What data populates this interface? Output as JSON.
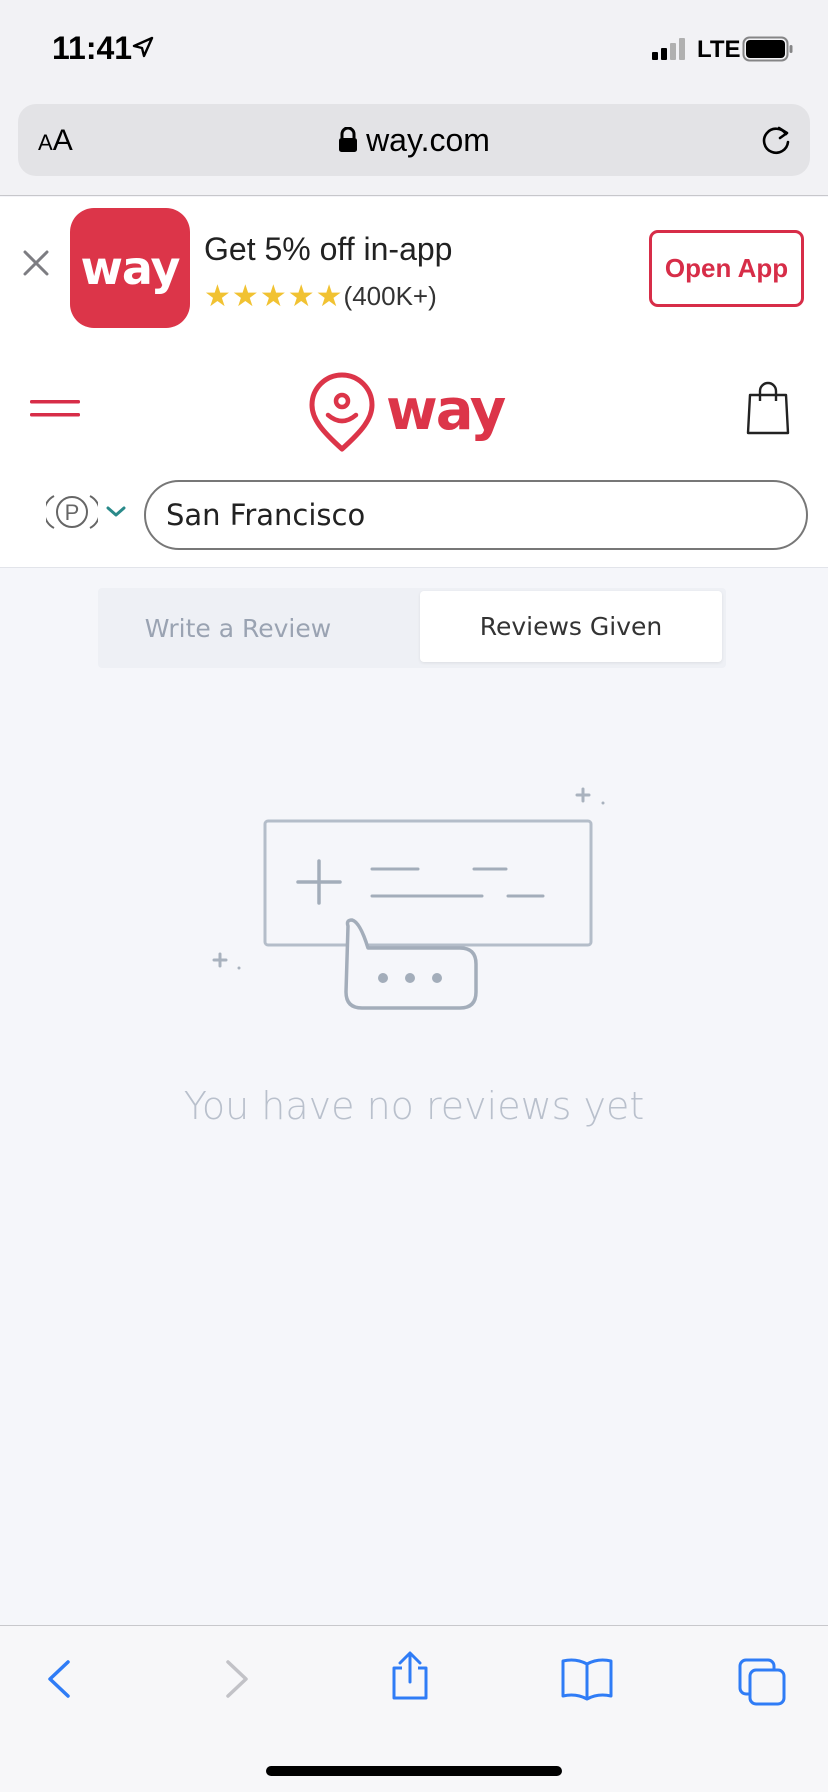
{
  "status_bar": {
    "time": "11:41",
    "network": "LTE"
  },
  "browser": {
    "aa_small": "A",
    "aa_big": "A",
    "url": "way.com"
  },
  "smart_banner": {
    "app_icon_text": "way",
    "title": "Get 5% off in-app",
    "stars": 5,
    "rating_count": "(400K+)",
    "open_button": "Open App"
  },
  "header": {
    "logo_text": "way",
    "parking_glyph": "P",
    "search": {
      "value": "San Francisco"
    }
  },
  "tabs": [
    {
      "label": "Write a Review",
      "active": false
    },
    {
      "label": "Reviews Given",
      "active": true
    }
  ],
  "empty_state": {
    "message": "You have no reviews yet"
  },
  "colors": {
    "brand": "#dc3549",
    "ios_blue": "#2f7cf6",
    "muted_text": "#b9c0cc",
    "star": "#f1c232"
  }
}
